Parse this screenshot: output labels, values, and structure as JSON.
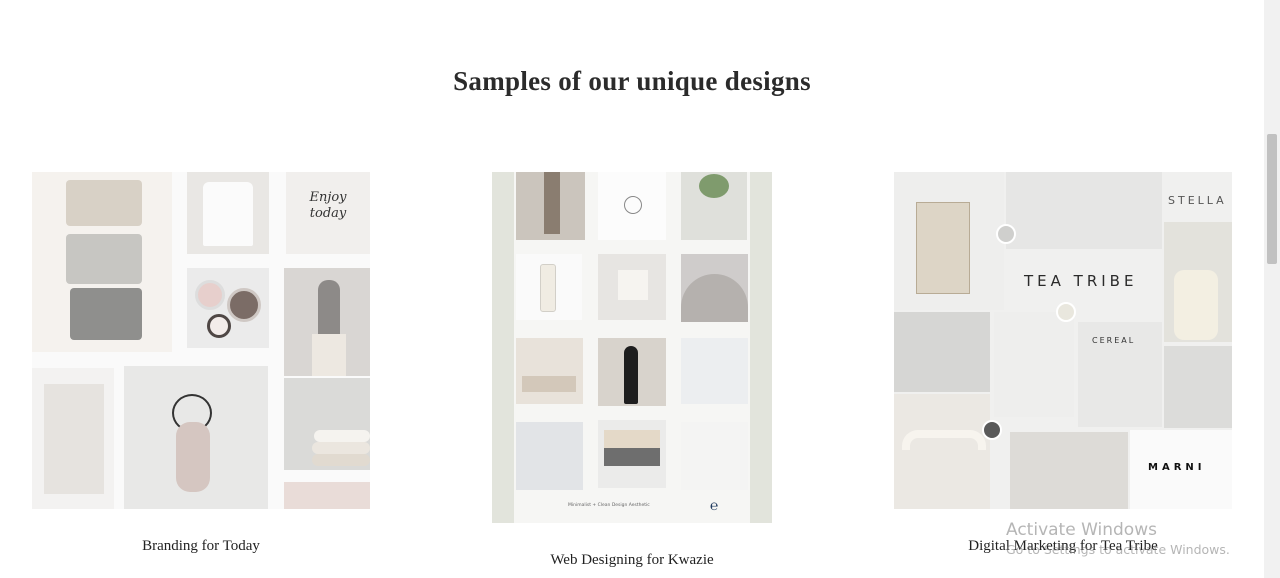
{
  "section": {
    "title": "Samples of our unique designs"
  },
  "cards": [
    {
      "caption": "Branding for Today",
      "inner_text": "Enjoy today"
    },
    {
      "caption": "Web Designing for Kwazie",
      "inner_text": "Minimalist + Clean Design Aesthetic"
    },
    {
      "caption": "Digital Marketing for Tea Tribe",
      "inner_text": {
        "brand": "TEA TRIBE",
        "brand2": "STELLA",
        "brand3": "CEREAL",
        "brand4": "MARNI"
      }
    }
  ],
  "watermark": {
    "line1": "Activate Windows",
    "line2": "Go to Settings to activate Windows."
  },
  "colors": {
    "background": "#ffffff",
    "text": "#222222",
    "palette_bg": "#e2e4dc"
  }
}
